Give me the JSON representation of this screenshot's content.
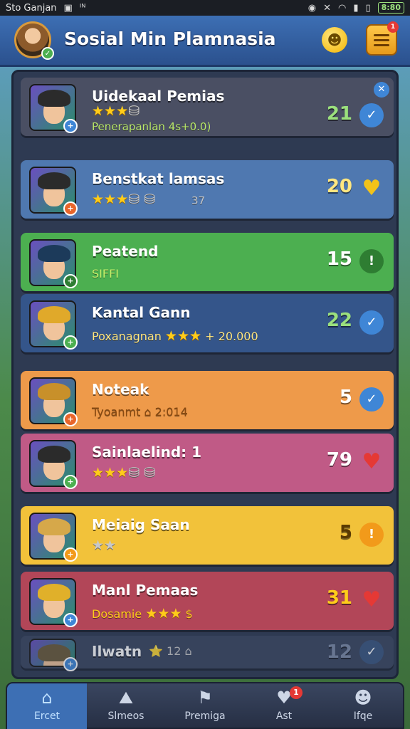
{
  "status_bar": {
    "carrier": "Sto Ganjan",
    "battery": "8:80"
  },
  "header": {
    "title": "Sosial Min Plamnasia",
    "menu_badge": "1"
  },
  "list": [
    {
      "name": "Uidekaal Pemias",
      "stars": 3,
      "sub": "Penerapanlan 4s+0.0)",
      "score": "21",
      "score_color": "#9be07d",
      "icon": "check",
      "icon_color": "#3f86d6",
      "row_color": "#4a4f63",
      "hair_color": "#2b2b2b",
      "badge_color": "#3f86d6"
    },
    {
      "name": "Benstkat lamsas",
      "stars": 3,
      "sub": "37",
      "score": "20",
      "score_color": "#ffe680",
      "icon": "heart",
      "icon_color": "#f2c21a",
      "row_color": "#4f78b0",
      "hair_color": "#2b2b2b",
      "badge_color": "#e8652a"
    },
    {
      "name": "Peatend",
      "stars": 0,
      "sub": "SIFFI",
      "score": "15",
      "score_color": "#ffffff",
      "icon": "info",
      "icon_color": "#2e7d32",
      "row_color": "#4caf50",
      "hair_color": "#1c3a5a",
      "badge_color": "#2e7d32"
    },
    {
      "name": "Kantal Gann",
      "stars": 3,
      "sub_prefix": "Poxanagnan",
      "sub_suffix": "+ 20.000",
      "score": "22",
      "score_color": "#9be07d",
      "icon": "check",
      "icon_color": "#3f86d6",
      "row_color": "#34558a",
      "hair_color": "#e0a92a",
      "badge_color": "#4caf50"
    },
    {
      "name": "Noteak",
      "stars": 0,
      "sub": "Tyoanmt ⌂ 2:014",
      "score": "5",
      "score_color": "#ffffff",
      "icon": "check",
      "icon_color": "#3f86d6",
      "row_color": "#ee9a4a",
      "hair_color": "#c8902a",
      "badge_color": "#e8652a"
    },
    {
      "name": "Sainlaelind: 1",
      "stars": 3,
      "sub": "",
      "score": "79",
      "score_color": "#ffffff",
      "icon": "heart",
      "icon_color": "#e53935",
      "row_color": "#c05a86",
      "hair_color": "#2b2b2b",
      "badge_color": "#4caf50"
    },
    {
      "name": "Meiaig Saan",
      "stars": 2,
      "stars_grey": true,
      "sub": "",
      "score": "5",
      "score_color": "#5a3a00",
      "icon": "info",
      "icon_color": "#f29a1a",
      "row_color": "#f2c23a",
      "hair_color": "#d6a84a",
      "badge_color": "#f29a1a"
    },
    {
      "name": "Manl Pemaas",
      "stars": 3,
      "sub_prefix": "Dosamie",
      "sub_suffix": "$",
      "score": "31",
      "score_color": "#ffcc1a",
      "icon": "heart",
      "icon_color": "#e53935",
      "row_color": "#b24658",
      "hair_color": "#e0b02a",
      "badge_color": "#3f86d6"
    },
    {
      "name": "Ilwatn",
      "stars": 0,
      "sub": "",
      "inline_extra": "⭐ 12 ⌂",
      "score": "12",
      "score_color": "#7c8aa6",
      "icon": "check",
      "icon_color": "#3a5680",
      "row_color": "#3b4660",
      "hair_color": "#6b5a3a",
      "badge_color": "#3f86d6"
    }
  ],
  "nav": [
    {
      "label": "Ercet",
      "icon": "⌂",
      "icon_name": "home-icon",
      "active": true
    },
    {
      "label": "Slmeos",
      "icon": "⛰",
      "icon_name": "landscape-icon",
      "active": false
    },
    {
      "label": "Premiga",
      "icon": "⚑",
      "icon_name": "compass-icon",
      "active": false
    },
    {
      "label": "Ast",
      "icon": "♥",
      "icon_name": "heart-icon",
      "active": false,
      "badge": "1"
    },
    {
      "label": "Ifqe",
      "icon": "☻",
      "icon_name": "profile-icon",
      "active": false
    }
  ]
}
